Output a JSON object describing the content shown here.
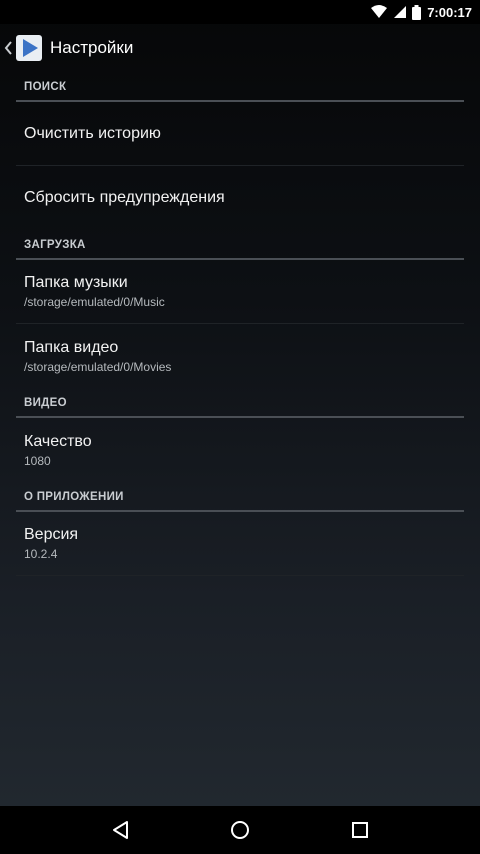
{
  "status_bar": {
    "time": "7:00:17",
    "icons": [
      "wifi-icon",
      "signal-icon",
      "battery-icon"
    ]
  },
  "action_bar": {
    "title": "Настройки",
    "icons": [
      "chevron-left-icon",
      "play-app-icon"
    ]
  },
  "sections": [
    {
      "header": "ПОИСК",
      "items": [
        {
          "title": "Очистить историю",
          "summary": ""
        },
        {
          "title": "Сбросить предупреждения",
          "summary": ""
        }
      ]
    },
    {
      "header": "ЗАГРУЗКА",
      "items": [
        {
          "title": "Папка музыки",
          "summary": "/storage/emulated/0/Music"
        },
        {
          "title": "Папка видео",
          "summary": "/storage/emulated/0/Movies"
        }
      ]
    },
    {
      "header": "ВИДЕО",
      "items": [
        {
          "title": "Качество",
          "summary": "1080"
        }
      ]
    },
    {
      "header": "О ПРИЛОЖЕНИИ",
      "items": [
        {
          "title": "Версия",
          "summary": "10.2.4"
        }
      ]
    }
  ],
  "nav_bar": {
    "icons": [
      "back-icon",
      "home-icon",
      "recents-icon"
    ]
  },
  "colors": {
    "accent": "#4a7fd0",
    "divider": "#4a4f55"
  }
}
